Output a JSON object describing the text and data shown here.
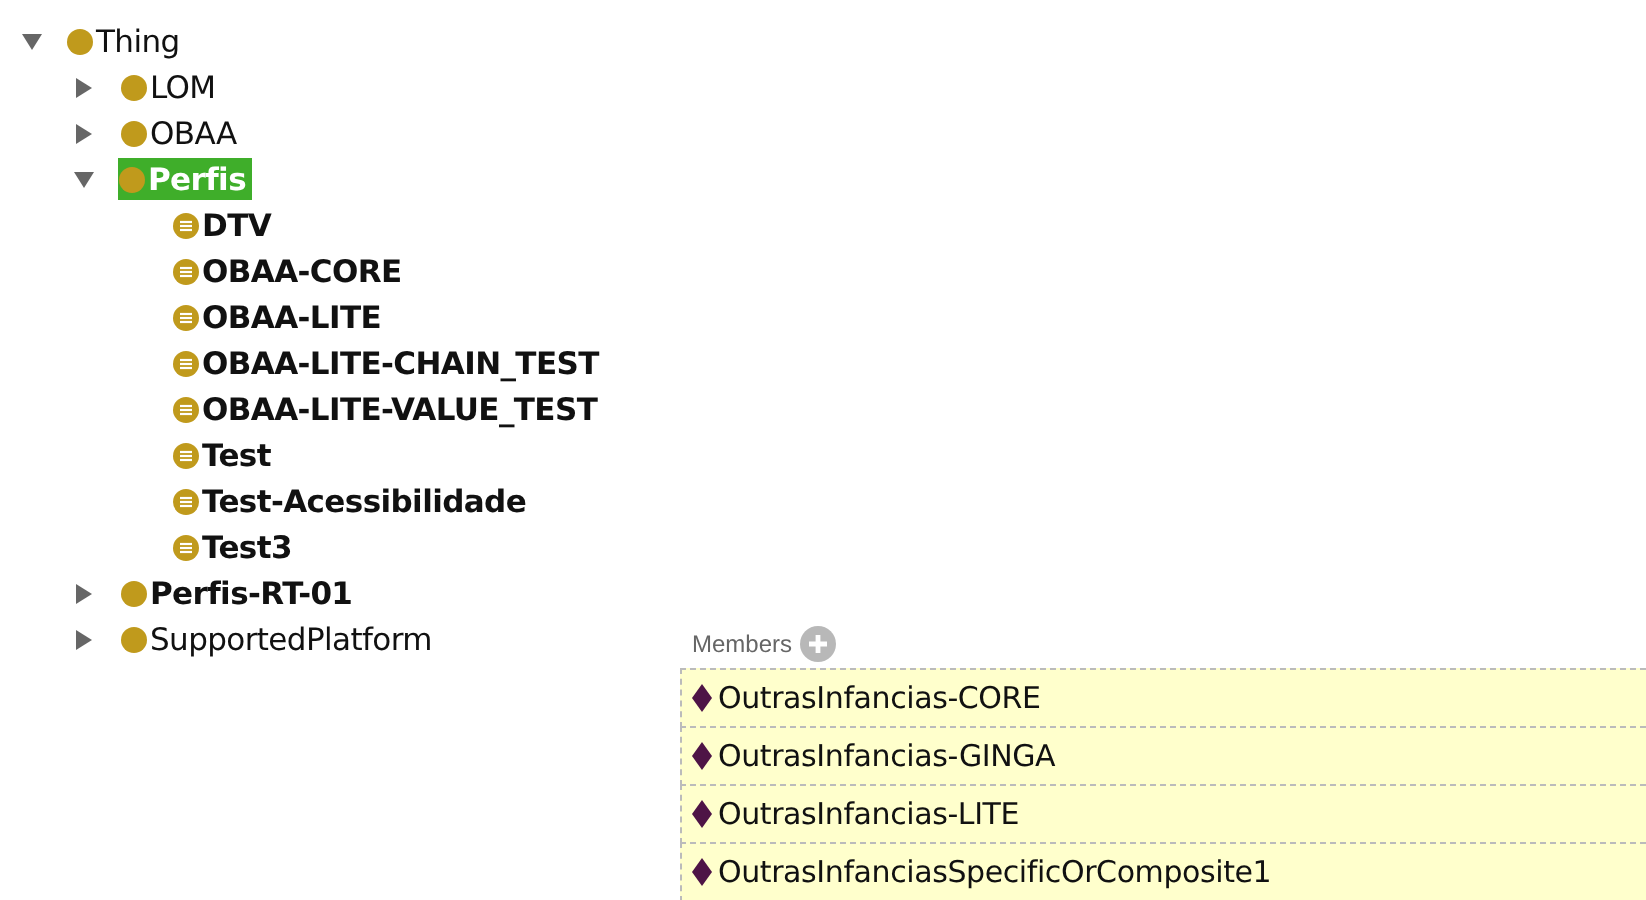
{
  "tree": [
    {
      "label": "Thing",
      "kind": "class",
      "bold": false,
      "selected": false,
      "expanded": true,
      "children": [
        {
          "label": "LOM",
          "kind": "class",
          "bold": false,
          "selected": false,
          "expanded": false
        },
        {
          "label": "OBAA",
          "kind": "class",
          "bold": false,
          "selected": false,
          "expanded": false
        },
        {
          "label": "Perfis",
          "kind": "class",
          "bold": true,
          "selected": true,
          "expanded": true,
          "children": [
            {
              "label": "DTV",
              "kind": "defined",
              "bold": true,
              "selected": false
            },
            {
              "label": "OBAA-CORE",
              "kind": "defined",
              "bold": true,
              "selected": false
            },
            {
              "label": "OBAA-LITE",
              "kind": "defined",
              "bold": true,
              "selected": false
            },
            {
              "label": "OBAA-LITE-CHAIN_TEST",
              "kind": "defined",
              "bold": true,
              "selected": false
            },
            {
              "label": "OBAA-LITE-VALUE_TEST",
              "kind": "defined",
              "bold": true,
              "selected": false
            },
            {
              "label": "Test",
              "kind": "defined",
              "bold": true,
              "selected": false
            },
            {
              "label": "Test-Acessibilidade",
              "kind": "defined",
              "bold": true,
              "selected": false
            },
            {
              "label": "Test3",
              "kind": "defined",
              "bold": true,
              "selected": false
            }
          ]
        },
        {
          "label": "Perfis-RT-01",
          "kind": "class",
          "bold": true,
          "selected": false,
          "expanded": false
        },
        {
          "label": "SupportedPlatform",
          "kind": "class",
          "bold": false,
          "selected": false,
          "expanded": false
        }
      ]
    }
  ],
  "members": {
    "title": "Members",
    "items": [
      {
        "label": "OutrasInfancias-CORE"
      },
      {
        "label": "OutrasInfancias-GINGA"
      },
      {
        "label": "OutrasInfancias-LITE"
      },
      {
        "label": "OutrasInfanciasSpecificOrComposite1"
      }
    ]
  }
}
